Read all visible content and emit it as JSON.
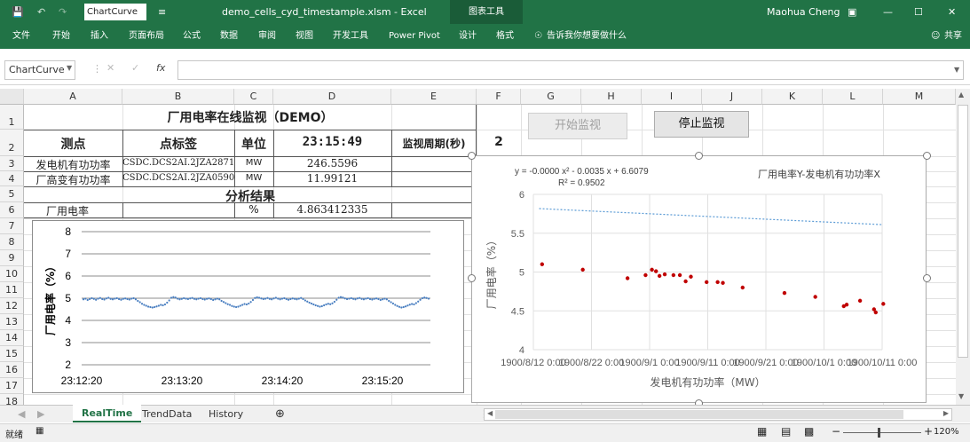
{
  "titlebar": {
    "namebox_small": "ChartCurve",
    "title": "demo_cells_cyd_timestample.xlsm - Excel",
    "context_tab": "图表工具",
    "user": "Maohua Cheng"
  },
  "ribbon": {
    "tabs": [
      "文件",
      "开始",
      "插入",
      "页面布局",
      "公式",
      "数据",
      "审阅",
      "视图",
      "开发工具",
      "Power Pivot",
      "设计",
      "格式"
    ],
    "tell": "告诉我你想要做什么",
    "share": "共享"
  },
  "formula_bar": {
    "name_box": "ChartCurve",
    "formula": ""
  },
  "columns": [
    "A",
    "B",
    "C",
    "D",
    "E",
    "F",
    "G",
    "H",
    "I",
    "J",
    "K",
    "L",
    "M"
  ],
  "rows": [
    "1",
    "2",
    "3",
    "4",
    "5",
    "6",
    "7",
    "8",
    "9",
    "10",
    "11",
    "12",
    "13",
    "14",
    "15",
    "16",
    "17",
    "18"
  ],
  "cells": {
    "title": "厂用电率在线监视（DEMO）",
    "h_point": "测点",
    "h_tag": "点标签",
    "h_unit": "单位",
    "h_time": "23:15:49",
    "h_period": "监视周期(秒)",
    "h_period_val": "2",
    "r3_name": "发电机有功功率",
    "r3_tag": "CSDC.DCS2AI.2JZA2871",
    "r3_unit": "MW",
    "r3_val": "246.5596",
    "r4_name": "厂高变有功功率",
    "r4_tag": "CSDC.DCS2AI.2JZA0590",
    "r4_unit": "MW",
    "r4_val": "11.99121",
    "analysis": "分析结果",
    "r6_name": "厂用电率",
    "r6_unit": "%",
    "r6_val": "4.863412335"
  },
  "buttons": {
    "start": "开始监视",
    "stop": "停止监视"
  },
  "sheet_tabs": [
    "RealTime",
    "TrendData",
    "History"
  ],
  "status": {
    "ready": "就绪",
    "zoom": "120%"
  },
  "chart_data": [
    {
      "type": "line",
      "ylabel": "厂用电率（%）",
      "ylim": [
        2,
        8
      ],
      "yticks": [
        "8",
        "7",
        "6",
        "5",
        "4",
        "3",
        "2"
      ],
      "xticks": [
        "23:12:20",
        "23:13:20",
        "23:14:20",
        "23:15:20"
      ],
      "series": [
        {
          "values": [
            4.95,
            4.98,
            4.92,
            4.96,
            5.0,
            4.97,
            4.93,
            4.98,
            5.01,
            4.96,
            4.94,
            4.99,
            5.02,
            4.97,
            4.95,
            4.98,
            5.0,
            4.96,
            4.93,
            4.97,
            4.99,
            4.96,
            4.94,
            4.98,
            5.0,
            4.95,
            4.88,
            4.82,
            4.75,
            4.7,
            4.66,
            4.62,
            4.6,
            4.58,
            4.6,
            4.63,
            4.66,
            4.7,
            4.68,
            4.72,
            4.8,
            4.9,
            5.02,
            5.05,
            5.03,
            4.98,
            4.95,
            4.97,
            5.0,
            4.98,
            4.96,
            4.99,
            5.01,
            4.97,
            4.95,
            4.98,
            5.0,
            4.96,
            4.94,
            4.97,
            4.99,
            4.96,
            4.92,
            4.95,
            4.98,
            4.95,
            4.88,
            4.83,
            4.78,
            4.73,
            4.7,
            4.65,
            4.62,
            4.6,
            4.62,
            4.66,
            4.7,
            4.74,
            4.72,
            4.76,
            4.83,
            4.92,
            5.01,
            5.04,
            5.02,
            4.99,
            4.96,
            4.98,
            5.01,
            4.97,
            4.95,
            4.99,
            5.02,
            4.98,
            4.95,
            4.98,
            5.0,
            4.96,
            4.93,
            4.96,
            4.99,
            4.97,
            4.95,
            4.98,
            5.01,
            4.96,
            4.9,
            4.85,
            4.8,
            4.76,
            4.72,
            4.68,
            4.65,
            4.62,
            4.64,
            4.68,
            4.72,
            4.75,
            4.73,
            4.77,
            4.84,
            4.93,
            5.02,
            5.05,
            5.03,
            4.99,
            4.96,
            4.98,
            5.0,
            4.97,
            4.95,
            4.99,
            5.01,
            4.97,
            4.95,
            4.98,
            5.0,
            4.96,
            4.94,
            4.97,
            4.99,
            4.96,
            4.92,
            4.95,
            4.98,
            4.95,
            4.88,
            4.82,
            4.76,
            4.7,
            4.65,
            4.61,
            4.58,
            4.6,
            4.63,
            4.67,
            4.71,
            4.74,
            4.72,
            4.78,
            4.85,
            4.93,
            5.0,
            5.03,
            5.01,
            4.98
          ]
        }
      ]
    },
    {
      "type": "scatter",
      "title": "厂用电率Y-发电机有功功率X",
      "xlabel": "发电机有功功率（MW）",
      "ylabel": "厂用电率（%）",
      "ylim": [
        4,
        6
      ],
      "yticks": [
        "6",
        "5.5",
        "5",
        "4.5",
        "4"
      ],
      "xticks": [
        "1900/8/12 0:00",
        "1900/8/22 0:00",
        "1900/9/1 0:00",
        "1900/9/11 0:00",
        "1900/9/21 0:00",
        "1900/10/1 0:00",
        "1900/10/11 0:00"
      ],
      "xlim": [
        225,
        285
      ],
      "equation": "y = -0.0000 x² - 0.0035 x + 6.6079",
      "r2": "R² = 0.9502",
      "series": [
        {
          "x": [
            226.5,
            233.5,
            241.2,
            244.3,
            245.4,
            246.1,
            246.7,
            247.6,
            249.1,
            250.2,
            251.2,
            252.1,
            254.8,
            256.7,
            257.6,
            261.0,
            268.2,
            273.5,
            278.4,
            278.9,
            281.2,
            283.6,
            283.9,
            285.2
          ],
          "y": [
            5.1,
            5.03,
            4.92,
            4.96,
            5.03,
            5.01,
            4.95,
            4.97,
            4.96,
            4.96,
            4.88,
            4.94,
            4.87,
            4.87,
            4.86,
            4.8,
            4.73,
            4.68,
            4.56,
            4.58,
            4.63,
            4.52,
            4.48,
            4.59
          ]
        }
      ],
      "trend": [
        6.6079,
        -0.0035
      ]
    }
  ]
}
